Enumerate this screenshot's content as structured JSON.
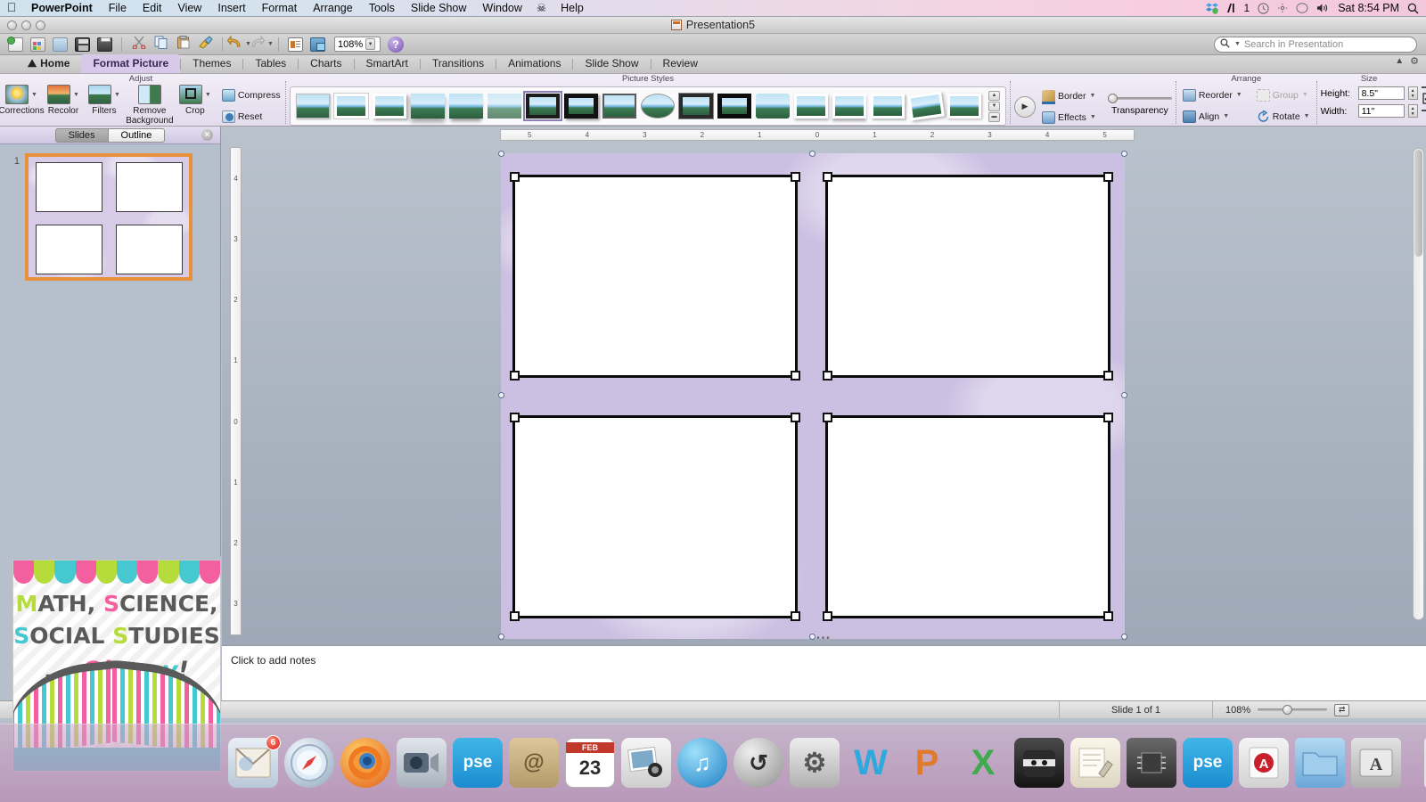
{
  "menubar": {
    "apple": "apple-logo",
    "app_name": "PowerPoint",
    "items": [
      "File",
      "Edit",
      "View",
      "Insert",
      "Format",
      "Arrange",
      "Tools",
      "Slide Show",
      "Window"
    ],
    "help": "Help",
    "status_icons": [
      "dropbox-icon",
      "adobe-icon",
      "clock-icon",
      "dropbox-sync-icon",
      "bluetooth-icon",
      "volume-icon"
    ],
    "adobe_count": "1",
    "clock": "Sat 8:54 PM",
    "spotlight": "search-icon"
  },
  "window": {
    "title": "Presentation5",
    "close": "close-button",
    "minimize": "minimize-button",
    "zoom": "zoom-button"
  },
  "toolbar": {
    "buttons": [
      {
        "name": "new-presentation",
        "glyph": "new-doc-icon"
      },
      {
        "name": "open-template",
        "glyph": "template-icon"
      },
      {
        "name": "save-as",
        "glyph": "save-as-icon"
      },
      {
        "name": "save",
        "glyph": "save-icon"
      },
      {
        "name": "print",
        "glyph": "print-icon"
      },
      {
        "name": "cut",
        "glyph": "scissors-icon"
      },
      {
        "name": "copy",
        "glyph": "copy-icon"
      },
      {
        "name": "paste",
        "glyph": "paste-icon"
      },
      {
        "name": "format-painter",
        "glyph": "paintbrush-icon"
      },
      {
        "name": "undo",
        "glyph": "undo-icon"
      },
      {
        "name": "redo",
        "glyph": "redo-icon"
      },
      {
        "name": "text-box",
        "glyph": "textbox-icon"
      },
      {
        "name": "media-browser",
        "glyph": "media-icon"
      }
    ],
    "zoom_value": "108%",
    "help": "?"
  },
  "search": {
    "placeholder": "Search in Presentation",
    "icon": "search-icon"
  },
  "ribbon": {
    "tabs": [
      {
        "label": "Home",
        "active": false,
        "icon": "home-icon"
      },
      {
        "label": "Format Picture",
        "active": true
      },
      {
        "label": "Themes",
        "active": false
      },
      {
        "label": "Tables",
        "active": false
      },
      {
        "label": "Charts",
        "active": false
      },
      {
        "label": "SmartArt",
        "active": false
      },
      {
        "label": "Transitions",
        "active": false
      },
      {
        "label": "Animations",
        "active": false
      },
      {
        "label": "Slide Show",
        "active": false
      },
      {
        "label": "Review",
        "active": false
      }
    ],
    "groups": {
      "adjust": {
        "title": "Adjust",
        "items": [
          {
            "label": "Corrections",
            "icon": "brightness-icon",
            "dropdown": true
          },
          {
            "label": "Recolor",
            "icon": "recolor-icon",
            "dropdown": true
          },
          {
            "label": "Filters",
            "icon": "filters-icon",
            "dropdown": true
          },
          {
            "label": "Remove Background",
            "icon": "remove-background-icon",
            "dropdown": false
          },
          {
            "label": "Crop",
            "icon": "crop-icon",
            "dropdown": true
          }
        ],
        "small_buttons": [
          {
            "label": "Compress",
            "icon": "compress-icon"
          },
          {
            "label": "Reset",
            "icon": "reset-icon"
          }
        ]
      },
      "picture_styles": {
        "title": "Picture Styles",
        "style_count": 16,
        "selected_index": 6,
        "scroll_up": "scroll-up-icon",
        "scroll_down": "scroll-down-icon",
        "more": "more-icon"
      },
      "format": {
        "border": {
          "label": "Border",
          "icon": "pencil-icon",
          "dropdown": true
        },
        "effects": {
          "label": "Effects",
          "icon": "effects-icon",
          "dropdown": true
        },
        "transparency": {
          "label": "Transparency",
          "value": 0
        }
      },
      "arrange": {
        "title": "Arrange",
        "items": [
          {
            "label": "Reorder",
            "icon": "reorder-icon",
            "dropdown": true,
            "enabled": true
          },
          {
            "label": "Group",
            "icon": "group-icon",
            "dropdown": true,
            "enabled": false
          },
          {
            "label": "Align",
            "icon": "align-icon",
            "dropdown": true,
            "enabled": true
          },
          {
            "label": "Rotate",
            "icon": "rotate-icon",
            "dropdown": true,
            "enabled": true
          }
        ]
      },
      "size": {
        "title": "Size",
        "height_label": "Height:",
        "height_value": "8.5\"",
        "width_label": "Width:",
        "width_value": "11\"",
        "lock_aspect": "lock-aspect-icon"
      }
    },
    "collapse": "collapse-ribbon-icon",
    "settings": "ribbon-settings-icon"
  },
  "slides_panel": {
    "tab_slides": "Slides",
    "tab_outline": "Outline",
    "active_tab": "Slides",
    "close": "close-panel-icon",
    "slides": [
      {
        "number": "1",
        "selected": true,
        "frames": 4
      }
    ]
  },
  "stage": {
    "ruler_h": [
      "5",
      "4",
      "3",
      "2",
      "1",
      "0",
      "1",
      "2",
      "3",
      "4",
      "5"
    ],
    "ruler_v": [
      "4",
      "3",
      "2",
      "1",
      "0",
      "1",
      "2",
      "3"
    ],
    "picture_count": 4,
    "selection": "multi-selected"
  },
  "notes": {
    "placeholder": "Click to add notes"
  },
  "statusbar": {
    "slide_counter": "Slide 1 of 1",
    "zoom_value": "108%",
    "zoom_percent": 108,
    "fit_button": "fit-to-window-icon"
  },
  "banner": {
    "line1_parts": [
      {
        "text": "M",
        "color": "#b5dc3b"
      },
      {
        "text": "ATH, ",
        "color": "#5a5a5a"
      },
      {
        "text": "S",
        "color": "#f45fa0"
      },
      {
        "text": "CIENCE,",
        "color": "#5a5a5a"
      }
    ],
    "line2_parts": [
      {
        "text": "S",
        "color": "#45c8d0"
      },
      {
        "text": "OCIAL ",
        "color": "#5a5a5a"
      },
      {
        "text": "S",
        "color": "#b5dc3b"
      },
      {
        "text": "TUDIES",
        "color": "#5a5a5a"
      }
    ],
    "line3_dots": ".....",
    "line3_parts": [
      {
        "text": "Oh,",
        "color": "#f45fa0"
      },
      {
        "text": "my",
        "color": "#45c8d0"
      },
      {
        "text": "!",
        "color": "#5a5a5a"
      }
    ],
    "alt": "math-science-social-studies-oh-my-blog-banner"
  },
  "dock": {
    "items": [
      {
        "name": "mail",
        "glyph": "✉",
        "badge": "6",
        "bg": "linear-gradient(#e8eef6,#b9c8d8)",
        "color": "#3a5a7a"
      },
      {
        "name": "safari",
        "glyph": "🧭",
        "badge": "",
        "bg": "radial-gradient(circle at 35% 30%,#f4f7fa,#8fa6bd)",
        "color": "#2a4a6a"
      },
      {
        "name": "firefox",
        "glyph": "🦊",
        "badge": "",
        "bg": "radial-gradient(circle at 35% 30%,#ffb64d,#e2601a)",
        "color": "#fff"
      },
      {
        "name": "facetime",
        "glyph": "📹",
        "badge": "",
        "bg": "linear-gradient(#d8dde3,#a9b2bc)",
        "color": "#2a3a4a"
      },
      {
        "name": "photoshop-elements",
        "glyph": "pse",
        "badge": "",
        "bg": "linear-gradient(#3fb6e8,#1c8fd0)",
        "color": "#ffffff"
      },
      {
        "name": "address-book",
        "glyph": "@",
        "badge": "",
        "bg": "linear-gradient(#d9c193,#b39a6a)",
        "color": "#6b5630"
      },
      {
        "name": "ical",
        "glyph": "23",
        "badge": "",
        "bg": "linear-gradient(#ffffff,#e8e8e8)",
        "color": "#2b2b2b"
      },
      {
        "name": "iphoto",
        "glyph": "🖼",
        "badge": "",
        "bg": "linear-gradient(#f2f2f2,#cfcfcf)",
        "color": "#555"
      },
      {
        "name": "itunes",
        "glyph": "♫",
        "badge": "",
        "bg": "radial-gradient(circle at 35% 30%,#8fd8f7,#1b7fc4)",
        "color": "#fff"
      },
      {
        "name": "time-machine",
        "glyph": "↺",
        "badge": "",
        "bg": "radial-gradient(circle at 35% 30%,#e9e9e9,#9a9a9a)",
        "color": "#2f2f2f"
      },
      {
        "name": "system-preferences",
        "glyph": "⚙",
        "badge": "",
        "bg": "linear-gradient(#e4e4e4,#b5b5b5)",
        "color": "#444"
      },
      {
        "name": "microsoft-word",
        "glyph": "W",
        "badge": "",
        "bg": "transparent",
        "color": "#2fa8dd"
      },
      {
        "name": "microsoft-powerpoint",
        "glyph": "P",
        "badge": "",
        "bg": "transparent",
        "color": "#e07a2c"
      },
      {
        "name": "microsoft-excel",
        "glyph": "X",
        "badge": "",
        "bg": "transparent",
        "color": "#3faa4e"
      },
      {
        "name": "app-ninja",
        "glyph": "🥷",
        "badge": "",
        "bg": "linear-gradient(#3a3a3a,#1a1a1a)",
        "color": "#fff"
      },
      {
        "name": "notes-pen",
        "glyph": "✎",
        "badge": "",
        "bg": "linear-gradient(#f6f2e6,#ddd6c2)",
        "color": "#555"
      },
      {
        "name": "chip-utility",
        "glyph": "▦",
        "badge": "",
        "bg": "linear-gradient(#5a5a5a,#2e2e2e)",
        "color": "#ddd"
      },
      {
        "name": "photoshop-elements-2",
        "glyph": "pse",
        "badge": "",
        "bg": "linear-gradient(#3fb6e8,#1c8fd0)",
        "color": "#ffffff"
      },
      {
        "name": "adobe-reader",
        "glyph": "A",
        "badge": "",
        "bg": "linear-gradient(#f0f0f0,#d2d2d2)",
        "color": "#c8202a"
      },
      {
        "name": "downloads-folder",
        "glyph": "📁",
        "badge": "",
        "bg": "linear-gradient(#a7d4ef,#6ba8d8)",
        "color": "#1c4a6a"
      },
      {
        "name": "fonts-folder",
        "glyph": "A",
        "badge": "",
        "bg": "linear-gradient(#dcdcdc,#b0b0b0)",
        "color": "#333"
      }
    ],
    "trash": "trash-icon"
  }
}
